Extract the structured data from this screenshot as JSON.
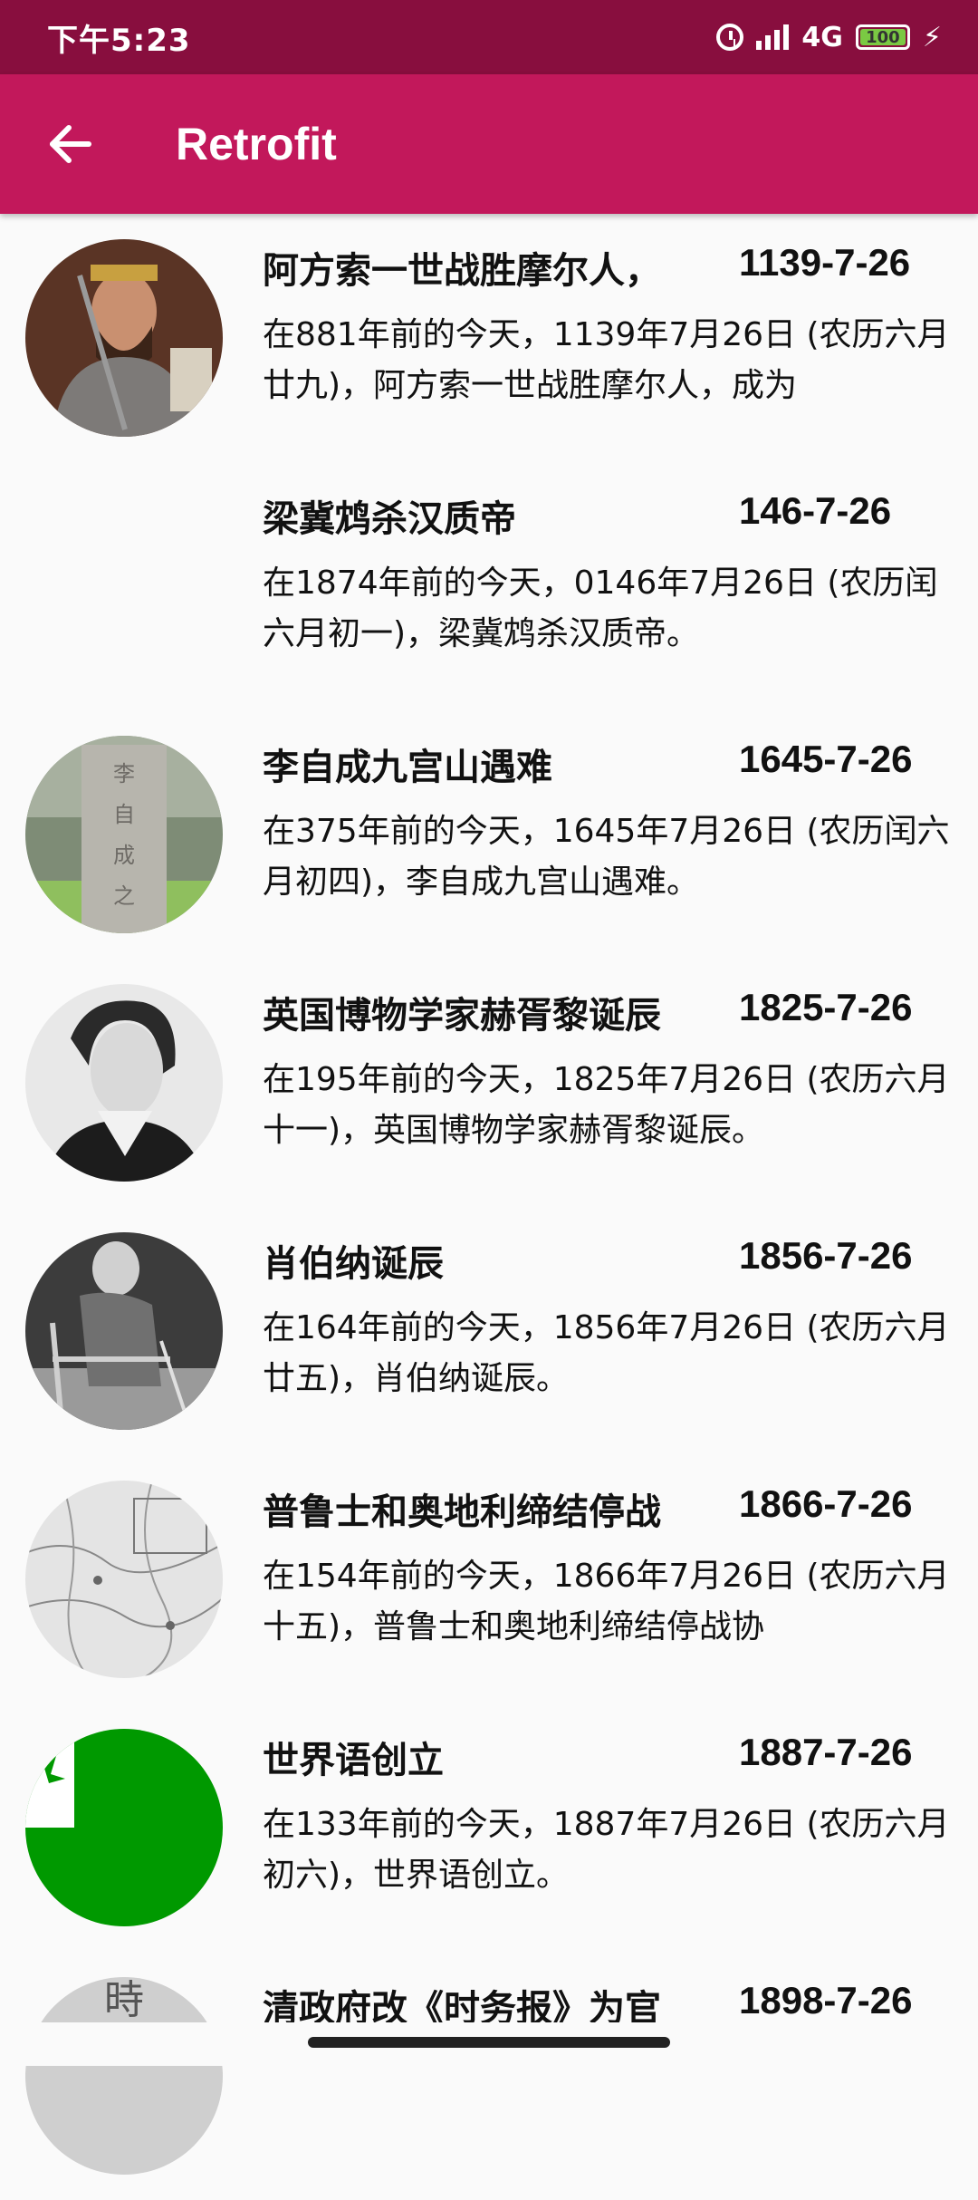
{
  "status_bar": {
    "time": "下午5:23",
    "network": "4G",
    "battery": "100"
  },
  "app_bar": {
    "title": "Retrofit",
    "back_icon": "arrow-left-icon"
  },
  "items": [
    {
      "title": "阿方索一世战胜摩尔人，",
      "date": "1139-7-26",
      "desc": "在881年前的今天，1139年7月26日 (农历六月廿九)，阿方索一世战胜摩尔人，成为",
      "thumb": "armored-king-portrait"
    },
    {
      "title": "梁冀鸩杀汉质帝",
      "date": "146-7-26",
      "desc": "在1874年前的今天，0146年7月26日 (农历闰六月初一)，梁冀鸩杀汉质帝。",
      "thumb": ""
    },
    {
      "title": "李自成九宫山遇难",
      "date": "1645-7-26",
      "desc": "在375年前的今天，1645年7月26日 (农历闰六月初四)，李自成九宫山遇难。",
      "thumb": "stone-tablet-photo"
    },
    {
      "title": "英国博物学家赫胥黎诞辰",
      "date": "1825-7-26",
      "desc": "在195年前的今天，1825年7月26日 (农历六月十一)，英国博物学家赫胥黎诞辰。",
      "thumb": "bw-portrait"
    },
    {
      "title": "肖伯纳诞辰",
      "date": "1856-7-26",
      "desc": "在164年前的今天，1856年7月26日 (农历六月廿五)，肖伯纳诞辰。",
      "thumb": "seated-man-photo"
    },
    {
      "title": "普鲁士和奥地利缔结停战",
      "date": "1866-7-26",
      "desc": "在154年前的今天，1866年7月26日 (农历六月十五)，普鲁士和奥地利缔结停战协",
      "thumb": "old-map"
    },
    {
      "title": "世界语创立",
      "date": "1887-7-26",
      "desc": "在133年前的今天，1887年7月26日 (农历六月初六)，世界语创立。",
      "thumb": "esperanto-flag"
    },
    {
      "title": "清政府改《时务报》为官",
      "date": "1898-7-26",
      "desc": "",
      "thumb": "newspaper-scan"
    }
  ],
  "colors": {
    "status_bar": "#880e3e",
    "app_bar": "#c2185b",
    "background": "#fafafa",
    "flag_green": "#009900"
  }
}
